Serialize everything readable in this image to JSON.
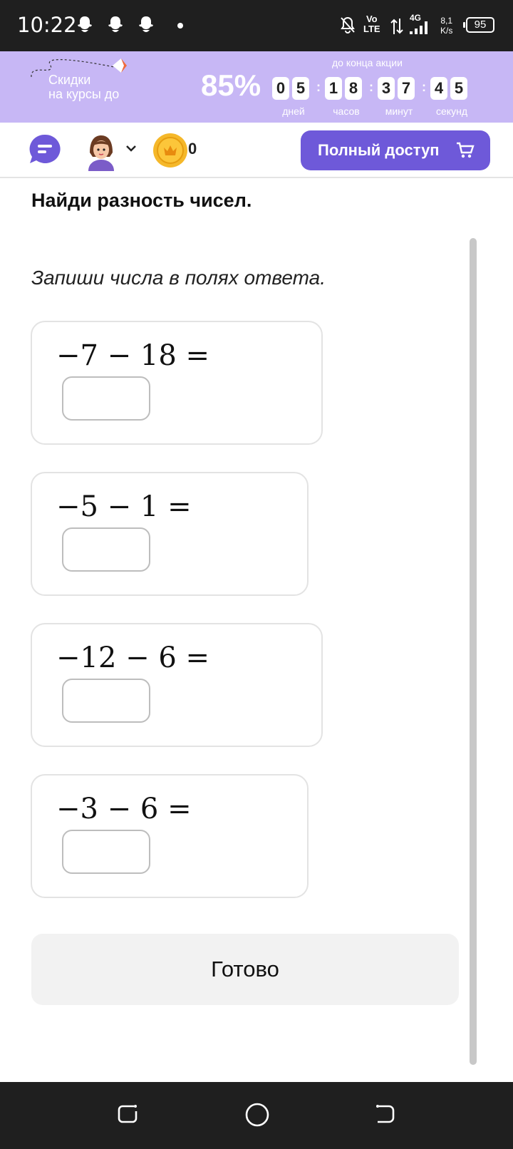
{
  "status_bar": {
    "time": "10:22",
    "network_volte_top": "Vo",
    "network_volte_bottom": "LTE",
    "network_type": "4G",
    "speed_value": "8,1",
    "speed_unit": "K/s",
    "battery": "95"
  },
  "promo": {
    "text_line1": "Скидки",
    "text_line2": "на курсы до",
    "percent": "85%",
    "until_label": "до конца акции",
    "countdown": {
      "days": [
        "0",
        "5"
      ],
      "hours": [
        "1",
        "8"
      ],
      "minutes": [
        "3",
        "7"
      ],
      "seconds": [
        "4",
        "5"
      ]
    },
    "unit_labels": {
      "days": "дней",
      "hours": "часов",
      "minutes": "минут",
      "seconds": "секунд"
    }
  },
  "toolbar": {
    "coins": "0",
    "full_access_label": "Полный доступ"
  },
  "task": {
    "title": "Найди разность чисел.",
    "instruction": "Запиши числа в полях ответа.",
    "problems": [
      {
        "expression": "−7 − 18 =",
        "answer": ""
      },
      {
        "expression": "−5 − 1 =",
        "answer": ""
      },
      {
        "expression": "−12 − 6 =",
        "answer": ""
      },
      {
        "expression": "−3 − 6 =",
        "answer": ""
      }
    ],
    "submit_label": "Готово"
  },
  "colors": {
    "accent": "#6e59d9",
    "promo_bg": "#c7b7f5",
    "coin": "#f5b82a"
  }
}
